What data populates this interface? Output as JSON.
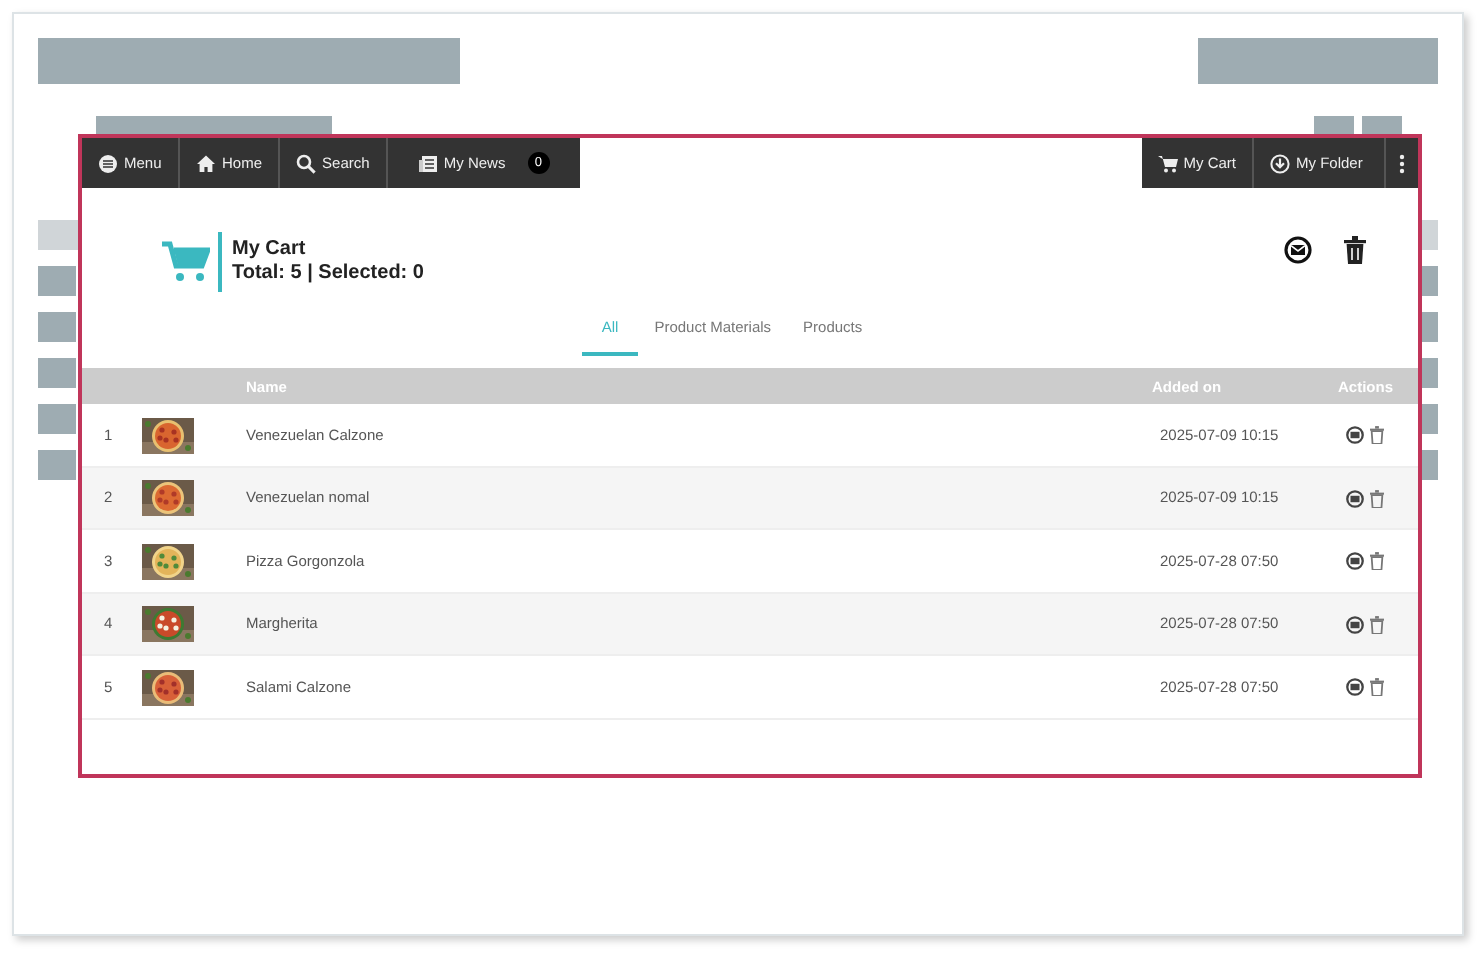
{
  "navbar": {
    "left": [
      {
        "kind": "menu",
        "label": "Menu"
      },
      {
        "kind": "home",
        "label": "Home"
      },
      {
        "kind": "search",
        "label": "Search"
      },
      {
        "kind": "news",
        "label": "My News",
        "badge": "0"
      }
    ],
    "right": [
      {
        "kind": "cart",
        "label": "My Cart"
      },
      {
        "kind": "folder",
        "label": "My Folder"
      },
      {
        "kind": "more"
      }
    ]
  },
  "header": {
    "title": "My Cart",
    "summary": "Total: 5 | Selected: 0"
  },
  "tabs": [
    {
      "label": "All",
      "selected": true
    },
    {
      "label": "Product Materials",
      "selected": false
    },
    {
      "label": "Products",
      "selected": false
    }
  ],
  "table": {
    "columns": [
      "Name",
      "Added on",
      "Actions"
    ],
    "rows": [
      {
        "number": "1",
        "name": "Venezuelan Calzone",
        "added_on": "2025-07-09 10:15"
      },
      {
        "number": "2",
        "name": "Venezuelan nomal",
        "added_on": "2025-07-09 10:15"
      },
      {
        "number": "3",
        "name": "Pizza Gorgonzola",
        "added_on": "2025-07-28 07:50"
      },
      {
        "number": "4",
        "name": "Margherita",
        "added_on": "2025-07-28 07:50"
      },
      {
        "number": "5",
        "name": "Salami Calzone",
        "added_on": "2025-07-28 07:50"
      }
    ]
  }
}
